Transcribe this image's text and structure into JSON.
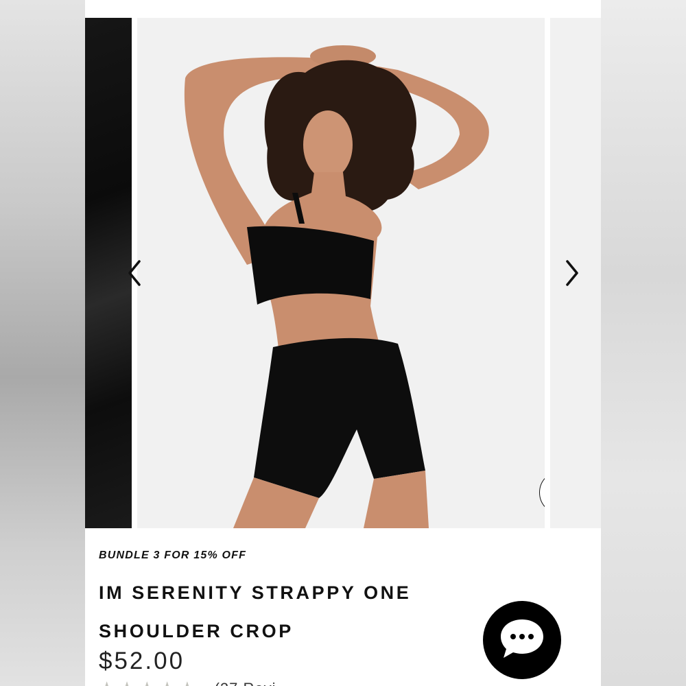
{
  "product": {
    "promo": "BUNDLE 3 FOR 15% OFF",
    "title_line1": "IM SERENITY STRAPPY ONE",
    "title_line2": "SHOULDER CROP",
    "price": "$52.00",
    "rating_count": "(27 Revi"
  },
  "icons": {
    "wishlist": "heart-icon",
    "prev": "chevron-left-icon",
    "next": "chevron-right-icon",
    "zoom": "magnifier-icon",
    "chat": "chat-bubble-icon",
    "stars": "star-icon"
  },
  "colors": {
    "accent": "#000000",
    "image_background": "#f1f1f1",
    "star_empty": "#c4c4bd"
  }
}
